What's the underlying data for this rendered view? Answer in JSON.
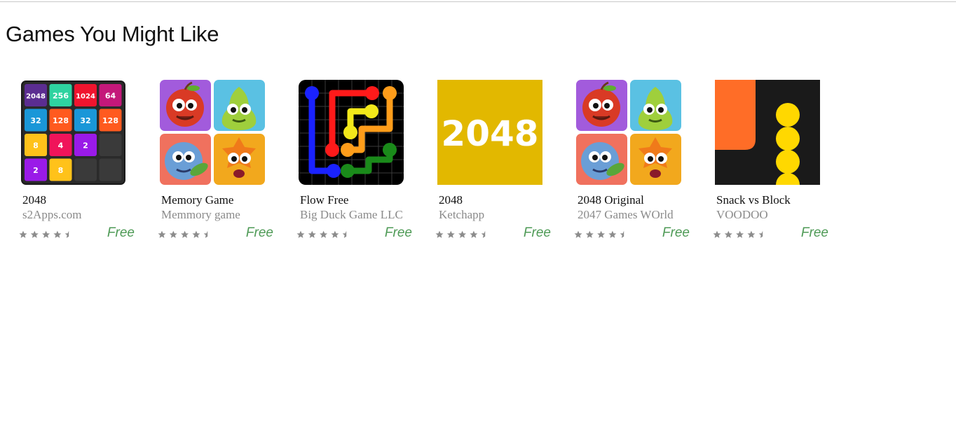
{
  "section": {
    "title": "Games You Might Like"
  },
  "games": [
    {
      "name": "2048",
      "developer": "s2Apps.com",
      "price": "Free",
      "rating": 4.5,
      "icon": "2048-tiles-icon",
      "tiles": [
        "2048",
        "256",
        "1024",
        "64",
        "32",
        "128",
        "32",
        "128",
        "8",
        "4",
        "2",
        "",
        "2",
        "8",
        "",
        ""
      ]
    },
    {
      "name": "Memory Game",
      "developer": "Memmory game",
      "price": "Free",
      "rating": 4.5,
      "icon": "fruit-characters-icon"
    },
    {
      "name": "Flow Free",
      "developer": "Big Duck Game LLC",
      "price": "Free",
      "rating": 4.5,
      "icon": "flow-pipes-icon"
    },
    {
      "name": "2048",
      "developer": "Ketchapp",
      "price": "Free",
      "rating": 4.5,
      "icon": "2048-logo-icon",
      "logo_text": "2048"
    },
    {
      "name": "2048 Original",
      "developer": "2047 Games WOrld",
      "price": "Free",
      "rating": 4.5,
      "icon": "fruit-characters-icon"
    },
    {
      "name": "Snack vs Block",
      "developer": "VOODOO",
      "price": "Free",
      "rating": 4.5,
      "icon": "snake-balls-icon"
    }
  ],
  "colors": {
    "price": "#4e9a56",
    "star": "#8c8c8c",
    "developer": "#8a8a8a"
  }
}
